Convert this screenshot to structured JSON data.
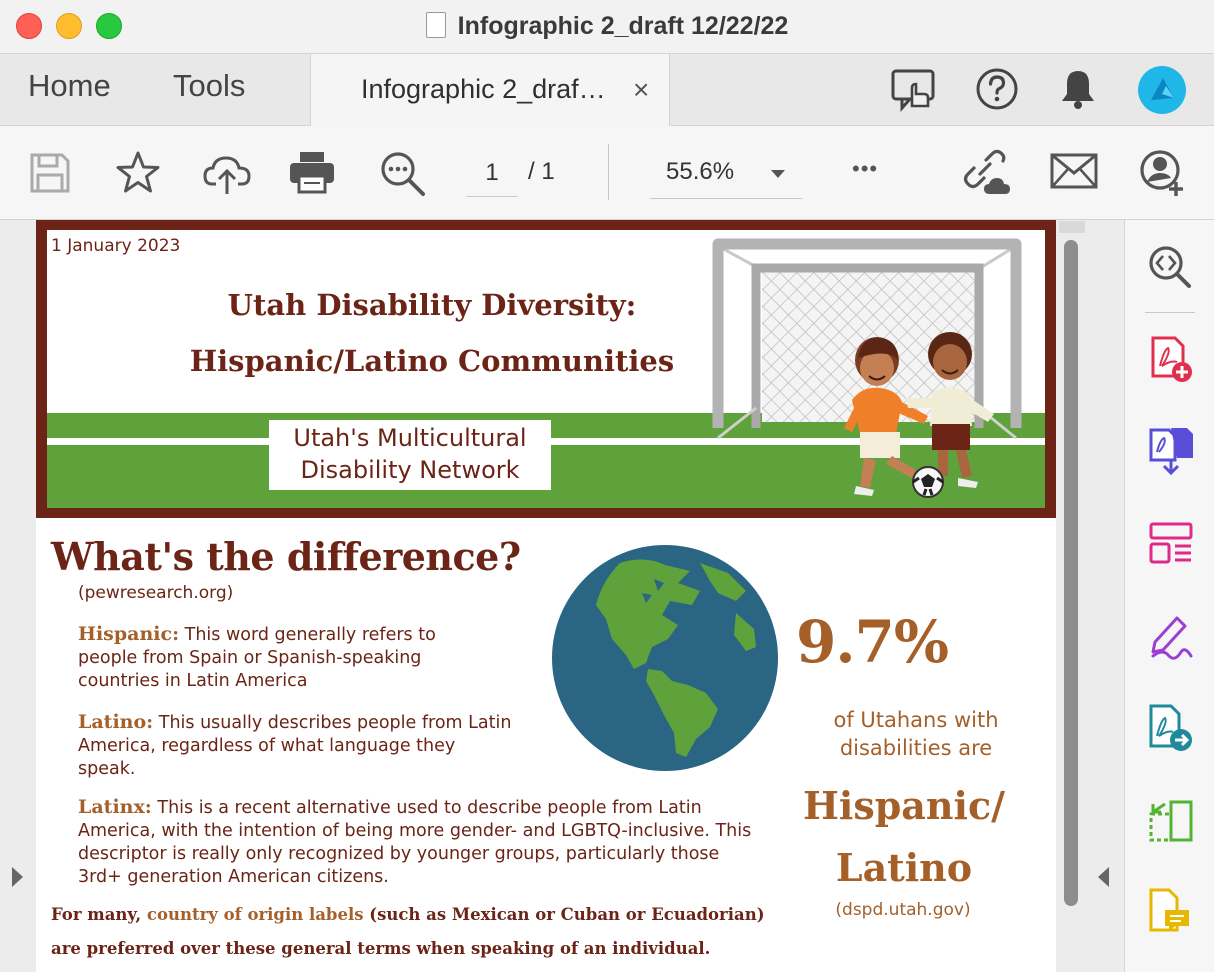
{
  "window": {
    "title": "Infographic 2_draft 12/22/22"
  },
  "tabs": {
    "home": "Home",
    "tools": "Tools",
    "document": "Infographic 2_draf…",
    "close": "×"
  },
  "toolbar": {
    "page_current": "1",
    "page_total": "/ 1",
    "zoom": "55.6%",
    "more": "•••"
  },
  "document": {
    "date": "1 January 2023",
    "title_line1": "Utah Disability Diversity:",
    "title_line2": "Hispanic/Latino Communities",
    "org_line1": "Utah's Multicultural",
    "org_line2": "Disability Network",
    "heading": "What's the difference?",
    "heading_source": "(pewresearch.org)",
    "definitions": [
      {
        "term": "Hispanic:",
        "text": "This word generally refers to people from Spain or Spanish-speaking countries in Latin America"
      },
      {
        "term": "Latino:",
        "text": "This usually describes people from Latin America, regardless of what language they speak."
      },
      {
        "term": "Latinx:",
        "text": "This is a recent alternative used to describe people from Latin America, with the intention of being more gender- and LGBTQ-inclusive. This descriptor is really only recognized by younger groups, particularly those 3rd+ generation American citizens."
      }
    ],
    "note_prefix": "For many, ",
    "note_highlight": "country of origin labels",
    "note_suffix": " (such as Mexican or Cuban or Ecuadorian) are preferred over these general terms when speaking of an individual.",
    "stat_value": "9.7%",
    "stat_desc_line1": "of Utahans with",
    "stat_desc_line2": "disabilities are",
    "stat_group_line1": "Hispanic/",
    "stat_group_line2": "Latino",
    "stat_source": "(dspd.utah.gov)"
  },
  "colors": {
    "brand_brown": "#6b2416",
    "amber": "#a5602a",
    "grass": "#5fa23c",
    "ocean": "#2a6584"
  },
  "icons": {
    "toolbar": [
      "save-icon",
      "bookmark-star-icon",
      "upload-cloud-icon",
      "print-icon",
      "zoom-search-icon",
      "link-cloud-icon",
      "email-icon",
      "add-user-icon"
    ],
    "tabbar": [
      "share-review-icon",
      "help-icon",
      "notification-bell-icon",
      "avatar"
    ],
    "sidebar": [
      "sidebar-zoom-icon",
      "create-pdf-icon",
      "combine-files-icon",
      "organize-pages-icon",
      "fill-sign-icon",
      "export-pdf-icon",
      "compress-icon",
      "comment-icon"
    ]
  }
}
